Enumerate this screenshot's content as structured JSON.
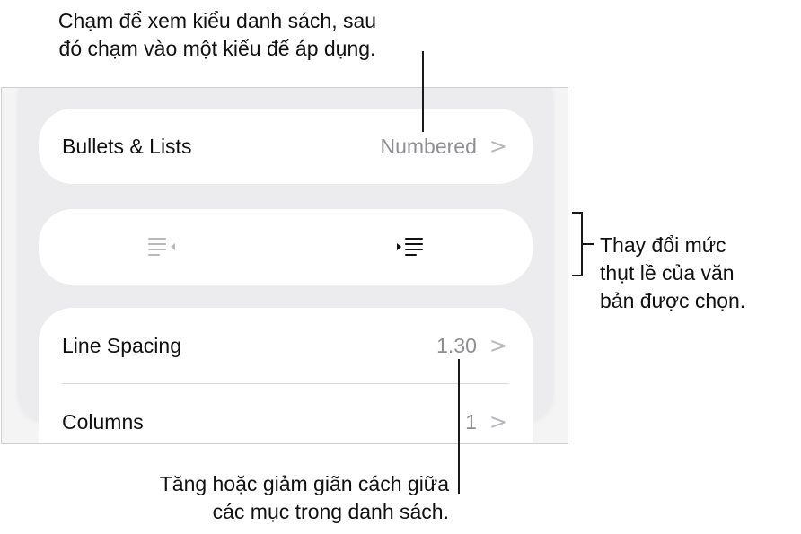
{
  "callouts": {
    "top": [
      "Chạm để xem kiểu danh sách, sau",
      "đó chạm vào một kiểu để áp dụng."
    ],
    "right": [
      "Thay đổi mức",
      "thụt lề của văn",
      "bản được chọn."
    ],
    "bottom": [
      "Tăng hoặc giảm giãn cách giữa",
      "các mục trong danh sách."
    ]
  },
  "panel": {
    "bullets": {
      "label": "Bullets & Lists",
      "value": "Numbered",
      "chevron": ">"
    },
    "indent": {
      "decrease_icon": "decrease-indent-icon",
      "increase_icon": "increase-indent-icon"
    },
    "line_spacing": {
      "label": "Line Spacing",
      "value": "1.30",
      "chevron": ">"
    },
    "columns": {
      "label": "Columns",
      "value": "1",
      "chevron": ">"
    }
  },
  "colors": {
    "value_text": "#8e8e93",
    "card": "#ffffff",
    "panel_bg": "#ececee",
    "disabled_icon": "#b8b8bd"
  }
}
